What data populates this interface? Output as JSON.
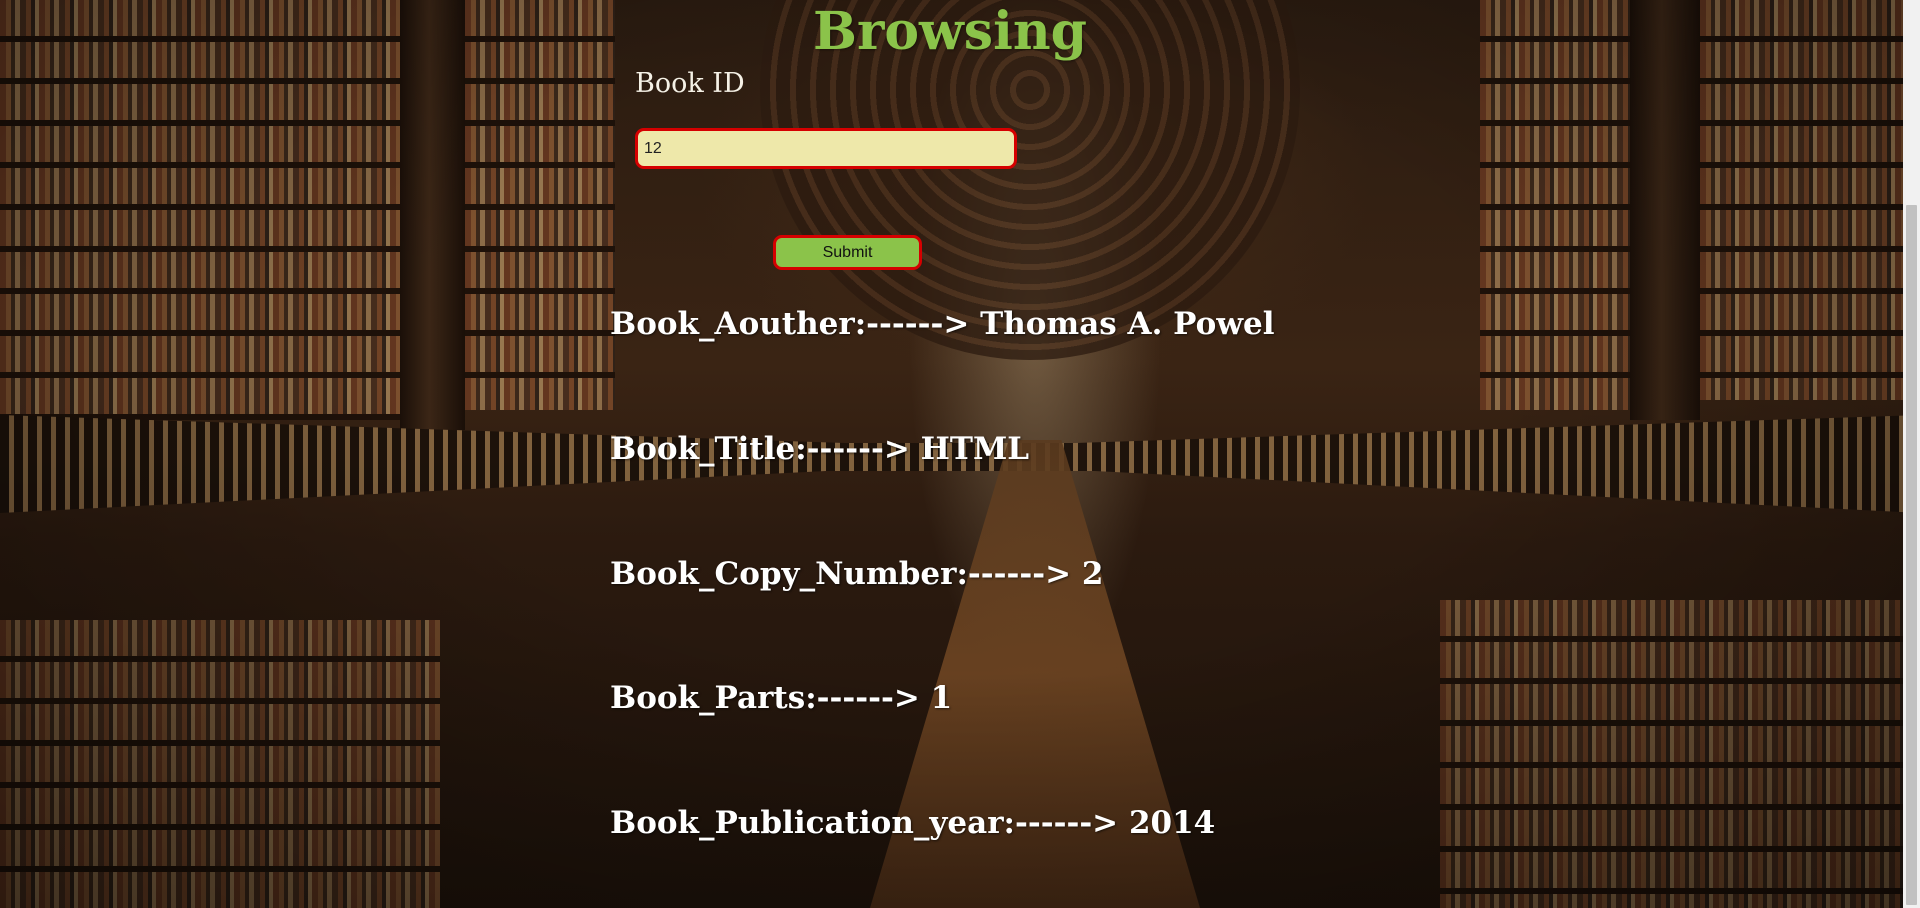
{
  "page": {
    "title": "Browsing"
  },
  "form": {
    "book_id_label": "Book ID",
    "book_id_value": "12",
    "submit_label": "Submit"
  },
  "results": [
    {
      "text": "Book_Aouther:------> Thomas A. Powel"
    },
    {
      "text": "Book_Title:------> HTML"
    },
    {
      "text": "Book_Copy_Number:------> 2"
    },
    {
      "text": "Book_Parts:------> 1"
    },
    {
      "text": "Book_Publication_year:------> 2014"
    }
  ],
  "colors": {
    "title_green": "#8bc34a",
    "input_background": "#eee8aa",
    "border_red": "#d50000",
    "result_text": "#ffffff"
  }
}
